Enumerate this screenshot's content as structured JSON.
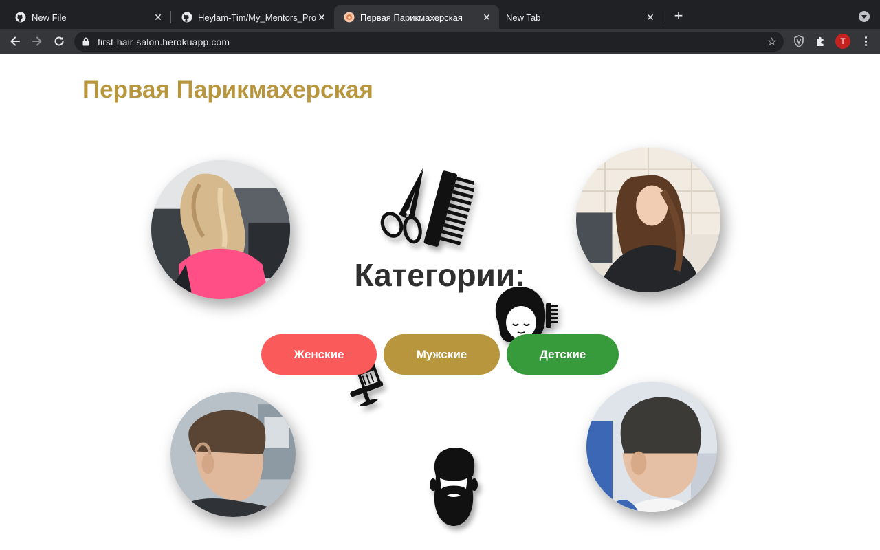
{
  "browser": {
    "tabs": [
      {
        "label": "New File",
        "favicon": "github-icon",
        "active": false
      },
      {
        "label": "Heylam-Tim/My_Mentors_Proje",
        "favicon": "github-icon",
        "active": false
      },
      {
        "label": "Первая Парикмахерская",
        "favicon": "salon-favicon-icon",
        "active": true
      },
      {
        "label": "New Tab",
        "favicon": "",
        "active": false
      }
    ],
    "new_tab": "+",
    "url": "first-hair-salon.herokuapp.com",
    "profile_initial": "T"
  },
  "page": {
    "title": "Первая Парикмахерская",
    "categories_heading": "Категории:",
    "buttons": [
      {
        "label": "Женские",
        "color": "#fb5a5a"
      },
      {
        "label": "Мужские",
        "color": "#b8963e"
      },
      {
        "label": "Детские",
        "color": "#379b3c"
      }
    ],
    "photos": [
      {
        "name": "woman-curly-blonde-photo"
      },
      {
        "name": "woman-long-brunette-photo"
      },
      {
        "name": "man-haircut-photo"
      },
      {
        "name": "child-haircut-photo"
      }
    ],
    "decorations": [
      "scissors-comb-icon",
      "woman-comb-icon",
      "barber-chair-icon",
      "bearded-man-icon"
    ]
  },
  "colors": {
    "accent": "#b8963e",
    "chrome_dark": "#202124",
    "chrome_toolbar": "#35363a"
  }
}
